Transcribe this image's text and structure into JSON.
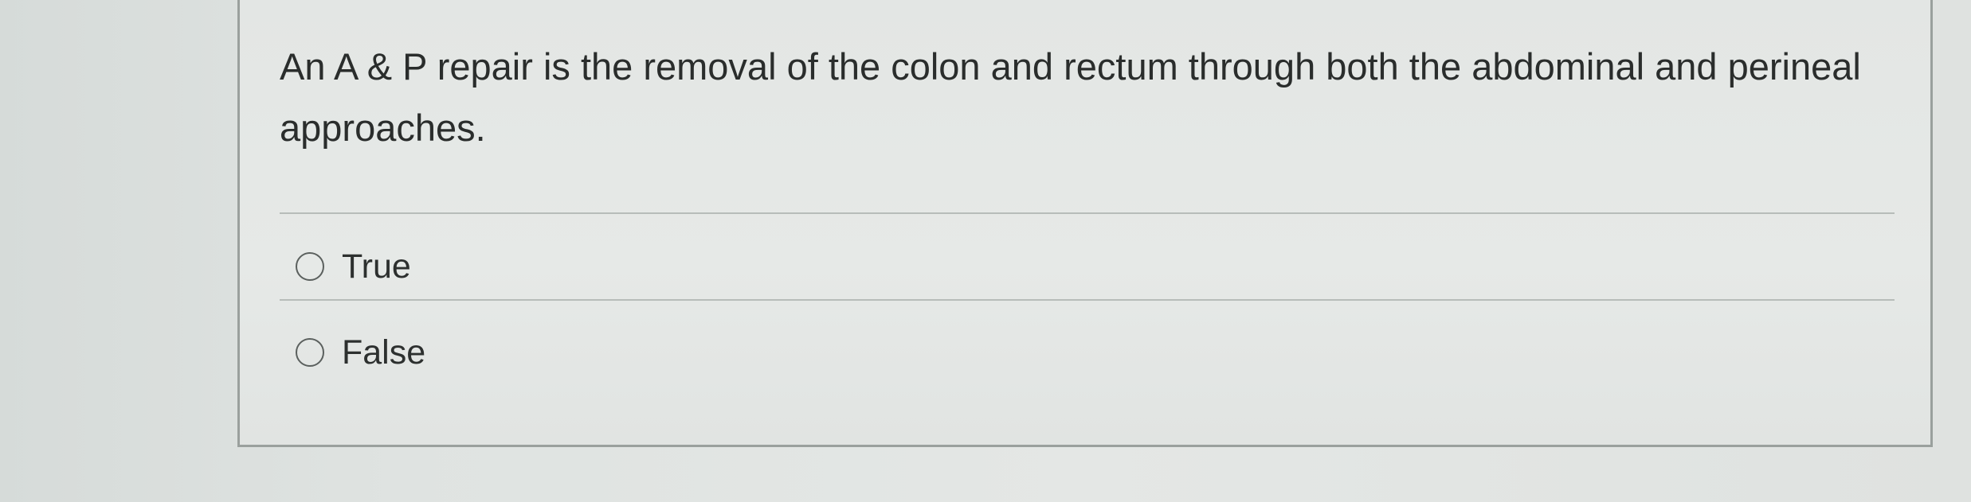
{
  "question": {
    "text": "An A & P repair is the removal of the colon and rectum through both the abdominal and perineal approaches."
  },
  "answers": [
    {
      "label": "True",
      "selected": false
    },
    {
      "label": "False",
      "selected": false
    }
  ]
}
